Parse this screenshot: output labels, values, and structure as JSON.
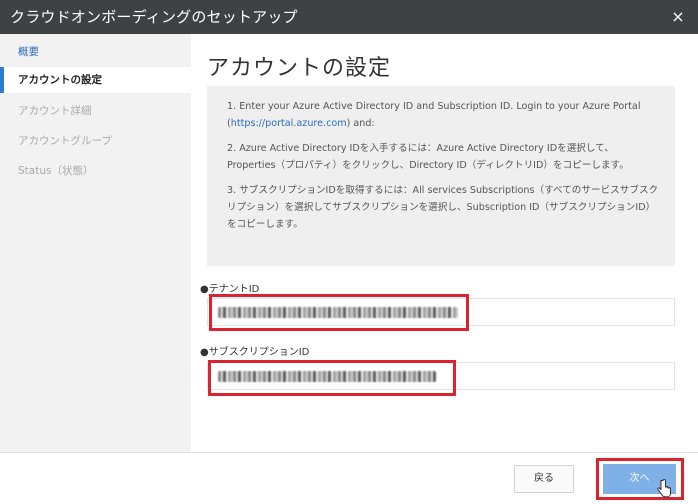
{
  "window": {
    "title": "クラウドオンボーディングのセットアップ",
    "close_label": "×"
  },
  "sidebar": {
    "items": [
      {
        "label": "概要",
        "state": "link"
      },
      {
        "label": "アカウントの設定",
        "state": "active"
      },
      {
        "label": "アカウント詳細",
        "state": "disabled"
      },
      {
        "label": "アカウントグループ",
        "state": "disabled"
      },
      {
        "label": "Status（状態）",
        "state": "disabled"
      }
    ]
  },
  "main": {
    "title": "アカウントの設定",
    "instructions": {
      "step1_before": "1. Enter your Azure Active Directory ID and Subscription ID. Login to your Azure Portal (",
      "step1_link": "https://portal.azure.com",
      "step1_after": ") and:",
      "step2": "2. Azure Active Directory IDを入手するには：Azure Active Directory IDを選択して、Properties（プロパティ）をクリックし、Directory ID（ディレクトリID）をコピーします。",
      "step3": "3. サブスクリプションIDを取得するには：All services Subscriptions（すべてのサービスサブスクリプション）を選択してサブスクリプションを選択し、Subscription ID（サブスクリプションID）をコピーします。"
    },
    "tenant": {
      "label": "●テナントID",
      "value_redacted": true
    },
    "subscription": {
      "label": "●サブスクリプションID",
      "value_redacted": true
    }
  },
  "footer": {
    "back_label": "戻る",
    "next_label": "次へ"
  },
  "colors": {
    "titlebar": "#3f4245",
    "accent": "#2b7cd3",
    "next_button": "#7fb1e8",
    "highlight": "#d9232f"
  }
}
